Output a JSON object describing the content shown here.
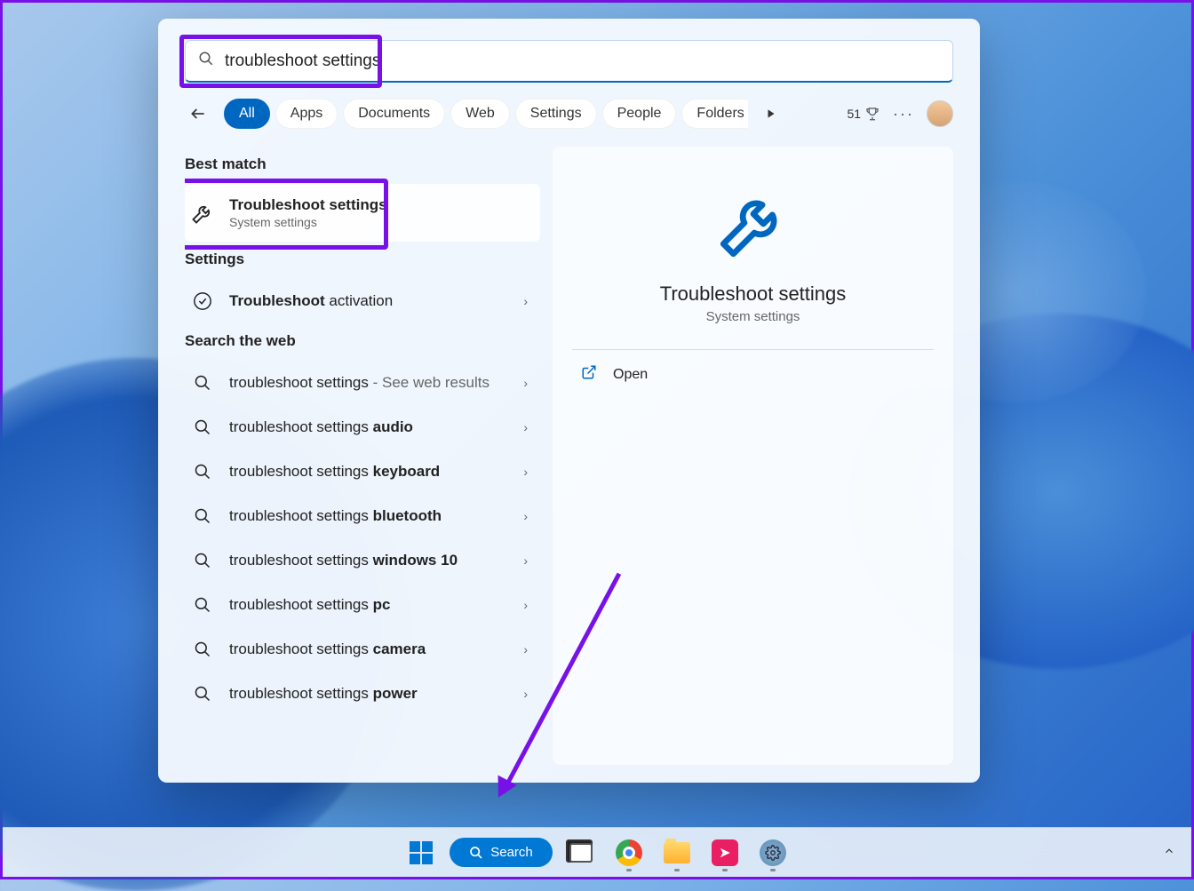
{
  "search": {
    "query": "troubleshoot settings"
  },
  "tabs": [
    "All",
    "Apps",
    "Documents",
    "Web",
    "Settings",
    "People",
    "Folders"
  ],
  "rewards_count": "51",
  "sections": {
    "best_match": "Best match",
    "settings": "Settings",
    "web": "Search the web"
  },
  "best": {
    "title": "Troubleshoot settings",
    "sub": "System settings"
  },
  "settings_items": [
    {
      "bold": "Troubleshoot",
      "rest": " activation"
    }
  ],
  "web_items": [
    {
      "plain": "troubleshoot settings",
      "suffix": " - See web results"
    },
    {
      "plain": "troubleshoot settings ",
      "bold": "audio"
    },
    {
      "plain": "troubleshoot settings ",
      "bold": "keyboard"
    },
    {
      "plain": "troubleshoot settings ",
      "bold": "bluetooth"
    },
    {
      "plain": "troubleshoot settings ",
      "bold": "windows 10"
    },
    {
      "plain": "troubleshoot settings ",
      "bold": "pc"
    },
    {
      "plain": "troubleshoot settings ",
      "bold": "camera"
    },
    {
      "plain": "troubleshoot settings ",
      "bold": "power"
    }
  ],
  "preview": {
    "title": "Troubleshoot settings",
    "sub": "System settings",
    "open": "Open"
  },
  "taskbar": {
    "search": "Search"
  }
}
